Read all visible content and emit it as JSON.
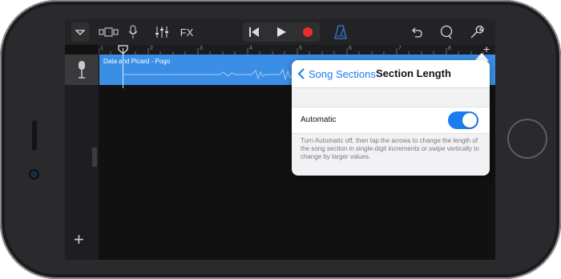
{
  "toolbar": {
    "fx_label": "FX",
    "buttons": [
      "tracks-view",
      "track-controls",
      "microphone",
      "mixer",
      "fx",
      "rewind",
      "play",
      "record",
      "metronome",
      "undo",
      "loop",
      "settings"
    ],
    "record_color": "#e5312a",
    "metronome_color": "#2f7de0"
  },
  "ruler": {
    "ticks": [
      "1",
      "2",
      "3",
      "4",
      "5",
      "6",
      "7",
      "8"
    ]
  },
  "track": {
    "region_title": "Data and Picard - Pogo",
    "region_color": "#3a8ee6"
  },
  "popover": {
    "back_label": "Song Sections",
    "title": "Section Length",
    "row_label": "Automatic",
    "toggle_on": true,
    "description": "Turn Automatic off, then tap the arrows to change the length of the song section in single-digit increments or swipe vertically to change by larger values.",
    "accent": "#1a7cf0"
  }
}
